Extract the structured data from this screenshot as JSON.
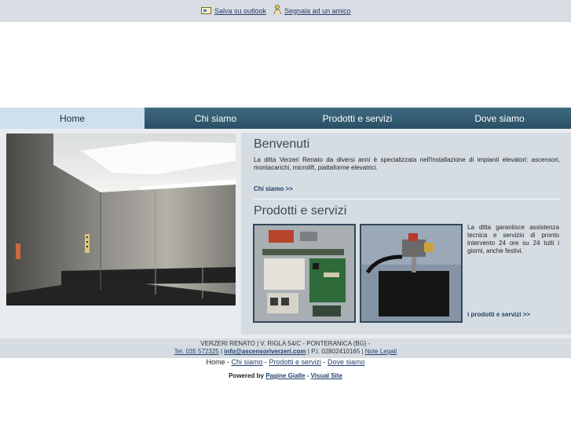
{
  "topbar": {
    "outlook_label": "Salva su outlook",
    "friend_label": "Segnala ad un amico"
  },
  "nav": {
    "tabs": [
      {
        "label": "Home",
        "active": true
      },
      {
        "label": "Chi siamo",
        "active": false
      },
      {
        "label": "Prodotti e servizi",
        "active": false
      },
      {
        "label": "Dove siamo",
        "active": false
      }
    ]
  },
  "welcome": {
    "title": "Benvenuti",
    "text": "La ditta Verzeri Renato da diversi anni è specializzata nell'installazione di impianti elevatori: ascensori, montacarichi, microlift, piattaforme elevatrici.",
    "link": "Chi siamo >>"
  },
  "products": {
    "title": "Prodotti e servizi",
    "text": "La ditta garantisce assistenza tecnica e servizio di pronto intervento 24 ore su 24 tutti i giorni, anche festivi.",
    "link": "i prodotti e servizi >>"
  },
  "footer": {
    "address": "VERZERI RENATO | V. RIGLA 54/C - PONTERANICA (BG) -",
    "phone": "Tel. 035 572325",
    "sep1": " | ",
    "email": "info@ascensoriverzeri.com",
    "vat": " | P.I. 02802410165 | ",
    "legal": "Note Legali"
  },
  "bottomnav": {
    "home": "Home",
    "sep": " - ",
    "chi": "Chi siamo",
    "prodotti": "Prodotti e servizi",
    "dove": "Dove siamo"
  },
  "powered": {
    "prefix": "Powered by ",
    "pagine": "Pagine Gialle",
    "sep": " - ",
    "visual": "Visual Site"
  },
  "colors": {
    "nav": "#2f5670",
    "nav_active": "#cfe0ec",
    "panel": "#d5dde3",
    "link": "#23406b"
  }
}
